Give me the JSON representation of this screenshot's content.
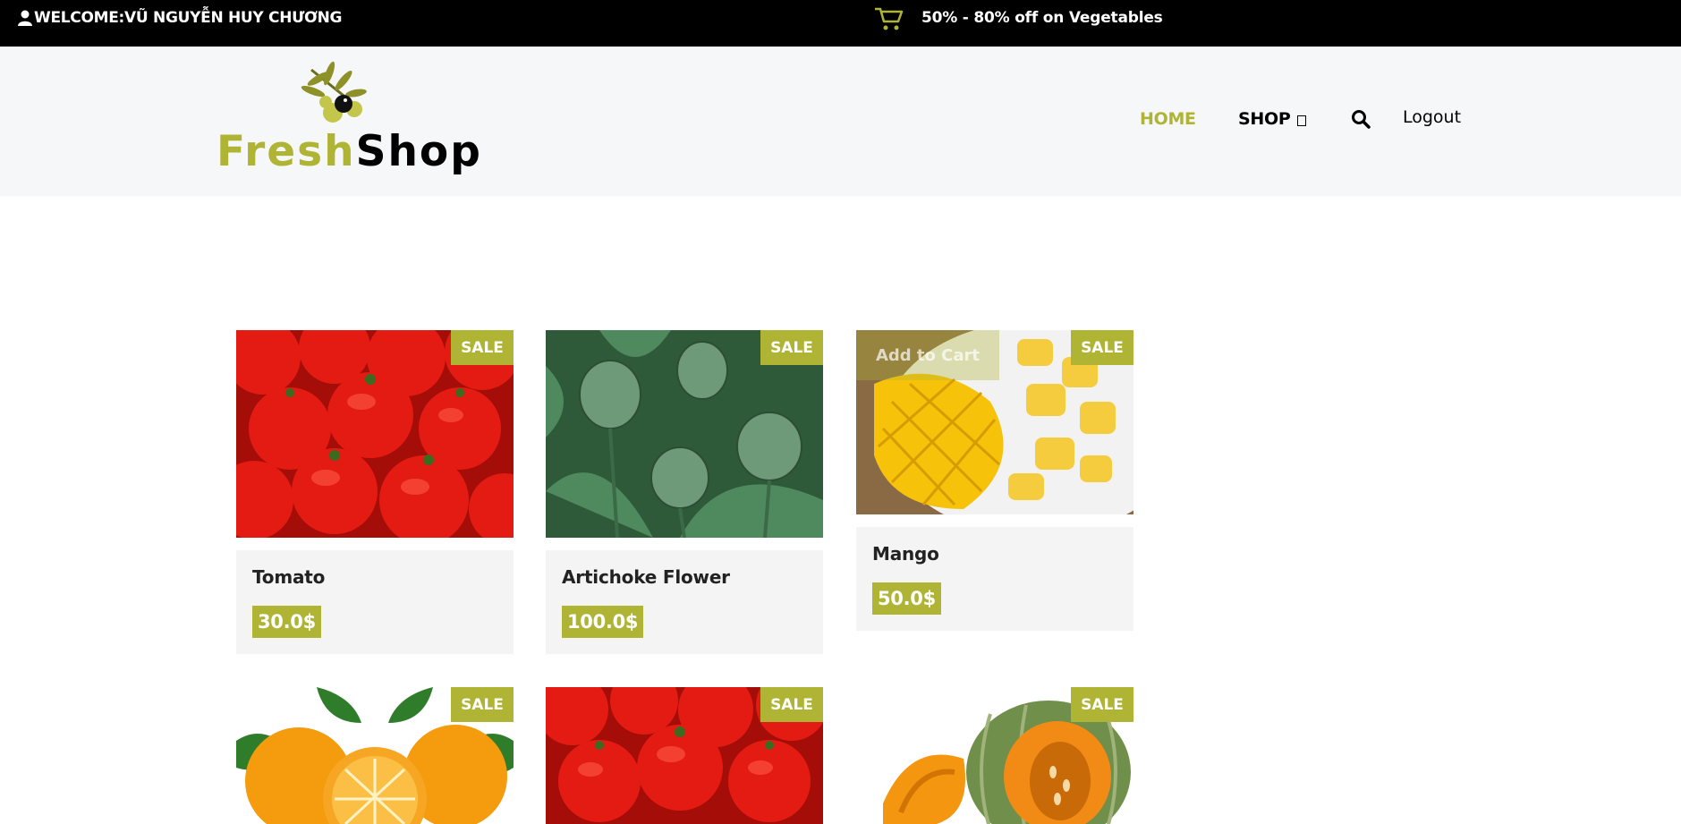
{
  "topbar": {
    "welcome": "WELCOME:VŨ NGUYỄN HUY CHƯƠNG",
    "promo": "50% - 80% off on Vegetables",
    "user_icon": "user-icon",
    "cart_icon": "shopping-cart-icon"
  },
  "logo": {
    "part1": "Fresh",
    "part2": "Shop"
  },
  "nav": {
    "home": "HOME",
    "shop": "SHOP",
    "shop_caret": "",
    "search_icon": "search-icon",
    "logout": "Logout"
  },
  "colors": {
    "accent": "#b0b435",
    "topbar": "#000000",
    "header": "#f6f7f9",
    "card": "#f4f4f4"
  },
  "products": [
    {
      "name": "Tomato",
      "price": "30.0$",
      "badge": "SALE",
      "image": "tomatoes"
    },
    {
      "name": "Artichoke Flower",
      "price": "100.0$",
      "badge": "SALE",
      "image": "artichokes"
    },
    {
      "name": "Mango",
      "price": "50.0$",
      "badge": "SALE",
      "image": "mango",
      "overlay": "Add to Cart"
    },
    {
      "name": "",
      "price": "",
      "badge": "SALE",
      "image": "oranges"
    },
    {
      "name": "",
      "price": "",
      "badge": "SALE",
      "image": "tomatoes"
    },
    {
      "name": "",
      "price": "",
      "badge": "SALE",
      "image": "pumpkin"
    }
  ]
}
